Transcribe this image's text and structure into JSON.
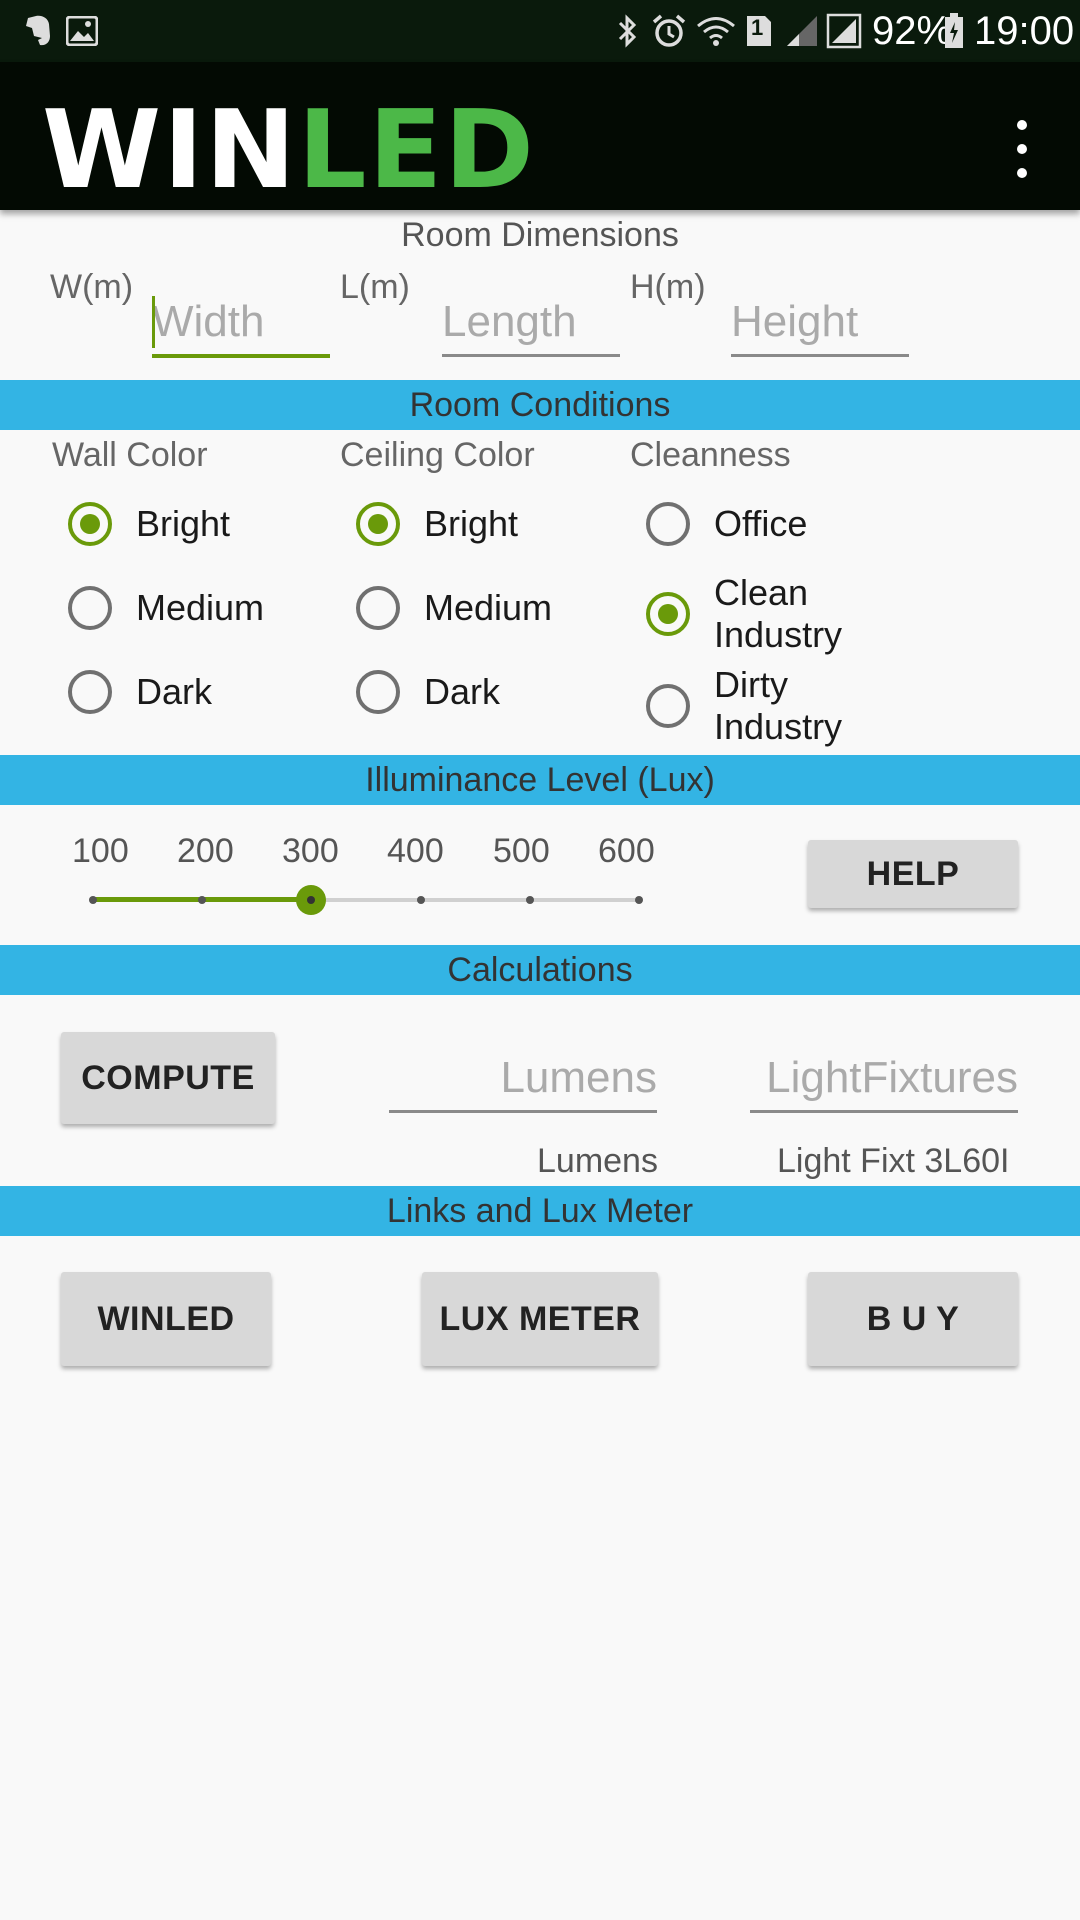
{
  "status_bar": {
    "battery": "92%",
    "time": "19:00",
    "sim_badge": "1",
    "icons": [
      "evernote-icon",
      "image-icon",
      "bluetooth-icon",
      "alarm-icon",
      "wifi-icon",
      "sim-icon",
      "signal-icon",
      "battery-icon"
    ]
  },
  "app_bar": {
    "logo_white": "WIN",
    "logo_green": "LED",
    "menu_icon": "overflow-menu-icon"
  },
  "room_dimensions": {
    "title": "Room Dimensions",
    "width_label": "W(m)",
    "width_placeholder": "Width",
    "length_label": "L(m)",
    "length_placeholder": "Length",
    "height_label": "H(m)",
    "height_placeholder": "Height"
  },
  "room_conditions": {
    "title": "Room Conditions",
    "wall": {
      "label": "Wall Color",
      "options": [
        "Bright",
        "Medium",
        "Dark"
      ],
      "selected": "Bright"
    },
    "ceiling": {
      "label": "Ceiling Color",
      "options": [
        "Bright",
        "Medium",
        "Dark"
      ],
      "selected": "Bright"
    },
    "cleanness": {
      "label": "Cleanness",
      "options": [
        "Office",
        "Clean Industry",
        "Dirty Industry"
      ],
      "selected": "Clean Industry"
    }
  },
  "illuminance": {
    "title": "Illuminance Level (Lux)",
    "ticks": [
      "100",
      "200",
      "300",
      "400",
      "500",
      "600"
    ],
    "selected_index": 2,
    "help_label": "HELP"
  },
  "calculations": {
    "title": "Calculations",
    "compute_label": "COMPUTE",
    "lumens_placeholder": "Lumens",
    "fixtures_placeholder": "LightFixtures",
    "lumens_caption": "Lumens",
    "fixtures_caption": "Light Fixt 3L60I"
  },
  "links": {
    "title": "Links and Lux Meter",
    "winled_label": "WINLED",
    "luxmeter_label": "LUX METER",
    "buy_label": "B U Y"
  },
  "colors": {
    "accent": "#6a9a0a",
    "banner": "#33b4e4",
    "logo_green": "#4cb848",
    "appbar": "#030a03"
  }
}
